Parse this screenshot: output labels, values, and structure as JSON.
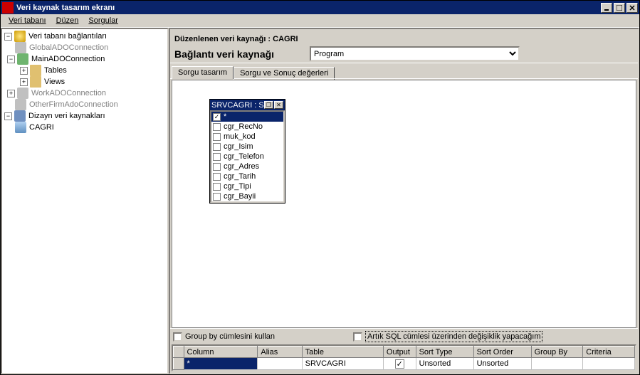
{
  "window_title": "Veri kaynak tasarım ekranı",
  "menu": {
    "m0": "Veri tabanı",
    "m1": "Düzen",
    "m2": "Sorgular"
  },
  "tree": {
    "root": "Veri tabanı bağlantıları",
    "global": "GlobalADOConnection",
    "main": "MainADOConnection",
    "tables": "Tables",
    "views": "Views",
    "work": "WorkADOConnection",
    "other": "OtherFirmAdoConnection",
    "design": "Dizayn veri kaynakları",
    "cagri": "CAGRI"
  },
  "header": {
    "title_prefix": "Düzenlenen veri kaynağı : ",
    "title_value": "CAGRI",
    "conn_label": "Bağlantı veri kaynağı",
    "conn_value": "Program"
  },
  "tabs": {
    "t0": "Sorgu tasarım",
    "t1": "Sorgu ve Sonuç değerleri"
  },
  "fieldwin": {
    "title": "SRVCAGRI : S",
    "items": [
      "*",
      "cgr_RecNo",
      "muk_kod",
      "cgr_Isim",
      "cgr_Telefon",
      "cgr_Adres",
      "cgr_Tarih",
      "cgr_Tipi",
      "cgr_Bayii"
    ],
    "checked": [
      true,
      false,
      false,
      false,
      false,
      false,
      false,
      false,
      false
    ]
  },
  "checks": {
    "c0": "Group by cümlesini kullan",
    "c1": "Artık SQL cümlesi üzerinden değişiklik yapacağım"
  },
  "grid": {
    "cols": [
      "Column",
      "Alias",
      "Table",
      "Output",
      "Sort Type",
      "Sort Order",
      "Group By",
      "Criteria"
    ],
    "row": {
      "column": "*",
      "alias": "",
      "table": "SRVCAGRI",
      "output": true,
      "sort_type": "Unsorted",
      "sort_order": "Unsorted",
      "group_by": "",
      "criteria": ""
    }
  },
  "chart_data": null
}
